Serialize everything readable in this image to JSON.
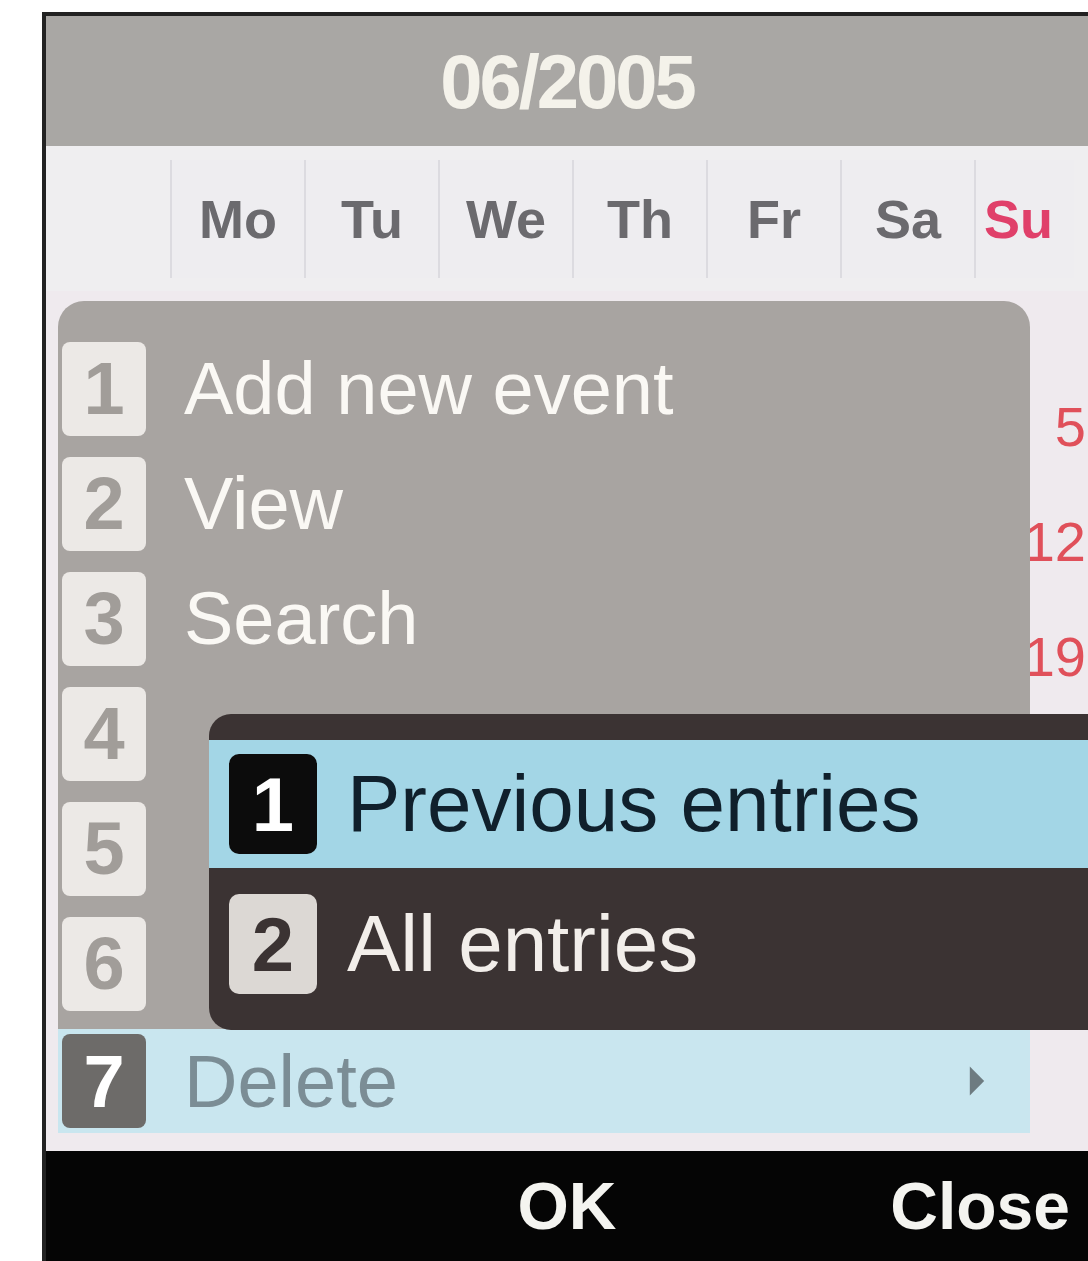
{
  "title": "06/2005",
  "weekdays": [
    {
      "label": "Mo",
      "kind": "weekday"
    },
    {
      "label": "Tu",
      "kind": "weekday"
    },
    {
      "label": "We",
      "kind": "weekday"
    },
    {
      "label": "Th",
      "kind": "weekday"
    },
    {
      "label": "Fr",
      "kind": "weekday"
    },
    {
      "label": "Sa",
      "kind": "weekday"
    },
    {
      "label": "Su",
      "kind": "sunday"
    }
  ],
  "days": [
    "5",
    "12",
    "19"
  ],
  "menu": {
    "items": [
      {
        "number": "1",
        "label": "Add new event",
        "selected": false,
        "submenu": false
      },
      {
        "number": "2",
        "label": "View",
        "selected": false,
        "submenu": false
      },
      {
        "number": "3",
        "label": "Search",
        "selected": false,
        "submenu": false
      },
      {
        "number": "4",
        "selected": false,
        "submenu": false
      },
      {
        "number": "5",
        "selected": false,
        "submenu": false
      },
      {
        "number": "6",
        "selected": false,
        "submenu": false
      },
      {
        "number": "7",
        "label": "Delete",
        "selected": true,
        "submenu": true
      }
    ]
  },
  "submenu": {
    "items": [
      {
        "number": "1",
        "label": "Previous entries",
        "selected": true
      },
      {
        "number": "2",
        "label": "All entries",
        "selected": false
      }
    ]
  },
  "softkeys": {
    "left": "OK",
    "right": "Close"
  }
}
